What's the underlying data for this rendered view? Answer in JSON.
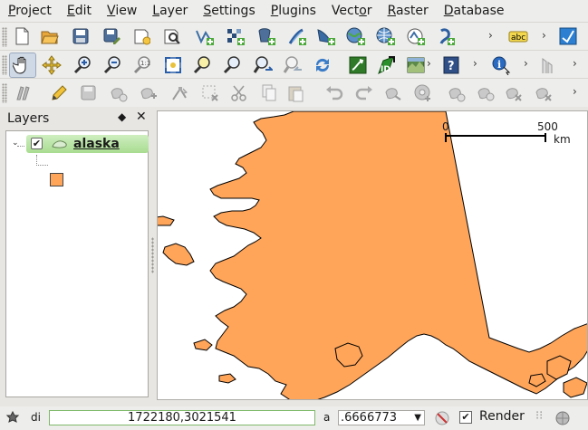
{
  "menubar": {
    "items": [
      "Project",
      "Edit",
      "View",
      "Layer",
      "Settings",
      "Plugins",
      "Vector",
      "Raster",
      "Database"
    ],
    "underline": [
      "P",
      "E",
      "V",
      "L",
      "S",
      "P",
      "o",
      "R",
      "D"
    ]
  },
  "toolbar1": {
    "buttons": [
      "new-project-icon",
      "open-project-icon",
      "save-project-icon",
      "save-as-icon",
      "new-print-composer-icon",
      "composer-manager-icon",
      "add-vector-layer-icon",
      "add-raster-layer-icon",
      "add-postgis-layer-icon",
      "add-spatialite-layer-icon",
      "add-mssql-layer-icon",
      "add-wms-layer-icon",
      "add-wfs-layer-icon",
      "new-shapefile-icon",
      "label-icon",
      "edit-label-icon"
    ],
    "label_text": "abc"
  },
  "toolbar2": {
    "buttons": [
      "pan-icon",
      "pan-to-selection-icon",
      "zoom-in-icon",
      "zoom-out-icon",
      "zoom-native-icon",
      "zoom-full-icon",
      "zoom-to-layer-icon",
      "zoom-to-selection-icon",
      "zoom-last-icon",
      "zoom-next-icon",
      "refresh-icon",
      "grass-tools-icon",
      "openlayers-icon",
      "georeferencer-icon",
      "help-icon",
      "identify-icon",
      "measure-icon"
    ]
  },
  "toolbar3": {
    "buttons": [
      "current-edits-icon",
      "toggle-editing-icon",
      "save-layer-edits-icon",
      "add-feature-icon",
      "move-feature-icon",
      "node-tool-icon",
      "delete-selected-icon",
      "cut-features-icon",
      "copy-features-icon",
      "paste-features-icon",
      "undo-icon",
      "redo-icon",
      "simplify-feature-icon",
      "add-ring-icon",
      "add-part-icon",
      "delete-ring-icon",
      "delete-part-icon",
      "reshape-features-icon"
    ]
  },
  "layers_panel": {
    "title": "Layers",
    "float_glyph": "◆",
    "close_glyph": "✕",
    "layers": [
      {
        "name": "alaska",
        "checked": true,
        "fill": "#ffa55a"
      }
    ]
  },
  "map": {
    "fill_color": "#ffa55a",
    "scalebar": {
      "start": "0",
      "end": "500",
      "unit": "km"
    }
  },
  "statusbar": {
    "coordinate_label_fragment": "di",
    "coordinate_value": "1722180,3021541",
    "scale_label_fragment": "a",
    "scale_value": ".6666773",
    "render_label": "Render",
    "render_checked": true
  },
  "colors": {
    "accent_green": "#a8dc90",
    "map_fill": "#ffa55a"
  }
}
